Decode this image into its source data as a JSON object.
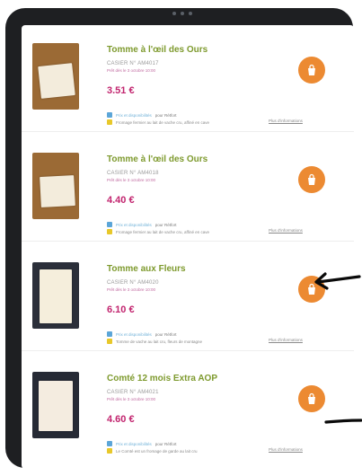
{
  "products": [
    {
      "name": "Tomme à l'œil des Ours",
      "crate": "CASIER N° AM4017",
      "date": "Prêt dès le 3 octobre 10:00",
      "price": "3.51 €",
      "availability": "Prix et disponibilités",
      "selection": "pour Rétfort",
      "description": "Fromage fermier au lait de vache cru, affiné en cave",
      "more_link": "Plus d'informations"
    },
    {
      "name": "Tomme à l'œil des Ours",
      "crate": "CASIER N° AM4018",
      "date": "Prêt dès le 3 octobre 10:00",
      "price": "4.40 €",
      "availability": "Prix et disponibilités",
      "selection": "pour Rétfort",
      "description": "Fromage fermier au lait de vache cru, affiné en cave",
      "more_link": "Plus d'informations"
    },
    {
      "name": "Tomme aux Fleurs",
      "crate": "CASIER N° AM4020",
      "date": "Prêt dès le 3 octobre 10:00",
      "price": "6.10 €",
      "availability": "Prix et disponibilités",
      "selection": "pour Rétfort",
      "description": "Tomme de vache au lait cru, fleurs de montagne",
      "more_link": "Plus d'informations"
    },
    {
      "name": "Comté 12 mois Extra AOP",
      "crate": "CASIER N° AM4021",
      "date": "Prêt dès le 3 octobre 10:00",
      "price": "4.60 €",
      "availability": "Prix et disponibilités",
      "selection": "pour Rétfort",
      "description": "Le Comté est un fromage de garde au lait cru",
      "more_link": "Plus d'informations"
    }
  ]
}
